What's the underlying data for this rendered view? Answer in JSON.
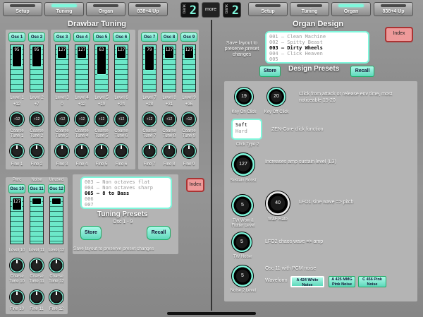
{
  "tabs_left": [
    "Setup",
    "Tuning",
    "Organ",
    "838+4 Up"
  ],
  "tabs_right": [
    "Setup",
    "Tuning",
    "Organ",
    "838+4 Up"
  ],
  "bank_left": {
    "label": "bank",
    "value": "2"
  },
  "bank_right": {
    "label": "bank",
    "value": "2"
  },
  "more_label": "more",
  "drawbar": {
    "title": "Drawbar Tuning",
    "oscs": [
      {
        "name": "Osc 1",
        "value": "95",
        "level": "Level 1",
        "tune": "+12",
        "coarse": "Coarse Tune 1",
        "fine": "Fine 1"
      },
      {
        "name": "Osc 2",
        "value": "95",
        "level": "Level 2",
        "tune": "+7",
        "coarse": "Coarse Tune 2",
        "fine": "Fine 2"
      },
      {
        "name": "Osc 3",
        "value": "127",
        "level": "Level 3",
        "tune": "0",
        "coarse": "Coarse Tune 3",
        "fine": "Fine 3"
      },
      {
        "name": "Osc 4",
        "value": "127",
        "level": "Level 4",
        "tune": "+12",
        "coarse": "Coarse Tune 4",
        "fine": "Fine 4"
      },
      {
        "name": "Osc 5",
        "value": "63",
        "level": "Level 5",
        "tune": "+19",
        "coarse": "Coarse Tune 5",
        "fine": "Fine 5"
      },
      {
        "name": "Osc 6",
        "value": "127",
        "level": "Level 6",
        "tune": "+24",
        "coarse": "Coarse Tune 6",
        "fine": "Fine 6"
      },
      {
        "name": "Osc 7",
        "value": "79",
        "level": "Level 7",
        "tune": "+28",
        "coarse": "Coarse Tune 7",
        "fine": "Fine 7"
      },
      {
        "name": "Osc 8",
        "value": "127",
        "level": "Level 8",
        "tune": "+31",
        "coarse": "Coarse Tune 8",
        "fine": "Fine 8"
      },
      {
        "name": "Osc 9",
        "value": "127",
        "level": "Level 9",
        "tune": "+36",
        "coarse": "Coarse Tune 9",
        "fine": "Fine 9"
      }
    ],
    "extras": [
      {
        "header": "Perc",
        "name": "Osc 10",
        "value": "127",
        "level": "Level 10",
        "coarse": "Coarse Tune 10",
        "fine": "Fine 10"
      },
      {
        "header": "Noise",
        "name": "Osc 11",
        "value": "",
        "level": "Level 11",
        "coarse": "Coarse Tune 11",
        "fine": "Fine 11"
      },
      {
        "header": "Unused",
        "name": "Osc 12",
        "value": "",
        "level": "Level 12",
        "coarse": "Coarse Tune 12",
        "fine": "Fine 12"
      }
    ],
    "knob_value": "+12"
  },
  "tuning_presets": {
    "title": "Tuning Presets",
    "subtitle": "Osc 1 - 9",
    "list": [
      "003 – Non octaves flat",
      "004 – Non octaves sharp",
      "005 – 8 to Bass",
      "006",
      "007"
    ],
    "selected": 2,
    "store": "Store",
    "recall": "Recall",
    "note": "Save layout to preserve preset changes",
    "index": "Index"
  },
  "organ": {
    "title": "Organ Design",
    "save_note": "Save layout to preserve preset changes",
    "presets_title": "Design Presets",
    "list": [
      "001 – Clean Machine",
      "002 – Spitty Beast",
      "003 – Dirty Wheels",
      "004 – Click Heaven",
      "005"
    ],
    "selected": 2,
    "store": "Store",
    "recall": "Recall",
    "index": "Index",
    "key_on_click": {
      "label": "Key On Click",
      "value": "19"
    },
    "key_off_click": {
      "label": "Key Off Click",
      "value": "20"
    },
    "click_note": "Click from attack or release env time, most noticeable 15-20",
    "click_type": {
      "options": [
        "Soft",
        "Hard"
      ],
      "selected": 0,
      "label": "Click Type 2"
    },
    "zen_note": "ZEN-Core click function",
    "sustain": {
      "label": "Sustain Boost",
      "value": "127",
      "note": "Increases amp sustain level (L3)"
    },
    "tw_wow": {
      "label": "TW Wow & Flutter Level",
      "value": "5"
    },
    "wf_rate": {
      "label": "W&F Rate",
      "value": "40"
    },
    "lfo1_note": "LFO1 sine wave => pitch",
    "tw_noise": {
      "label": "TW Noise",
      "value": "5",
      "note": "LFO2 chaos wave => amp"
    },
    "noise2": {
      "label": "Noise 2 Level",
      "value": "5"
    },
    "osc11_note": "Osc 11 with PCM noise",
    "waveform_label": "Waveform",
    "waveforms": [
      "A 424 White Noise",
      "A 425 MMG Pink Noise",
      "C 456 Pink Noise"
    ],
    "waveform_selected": 0
  }
}
